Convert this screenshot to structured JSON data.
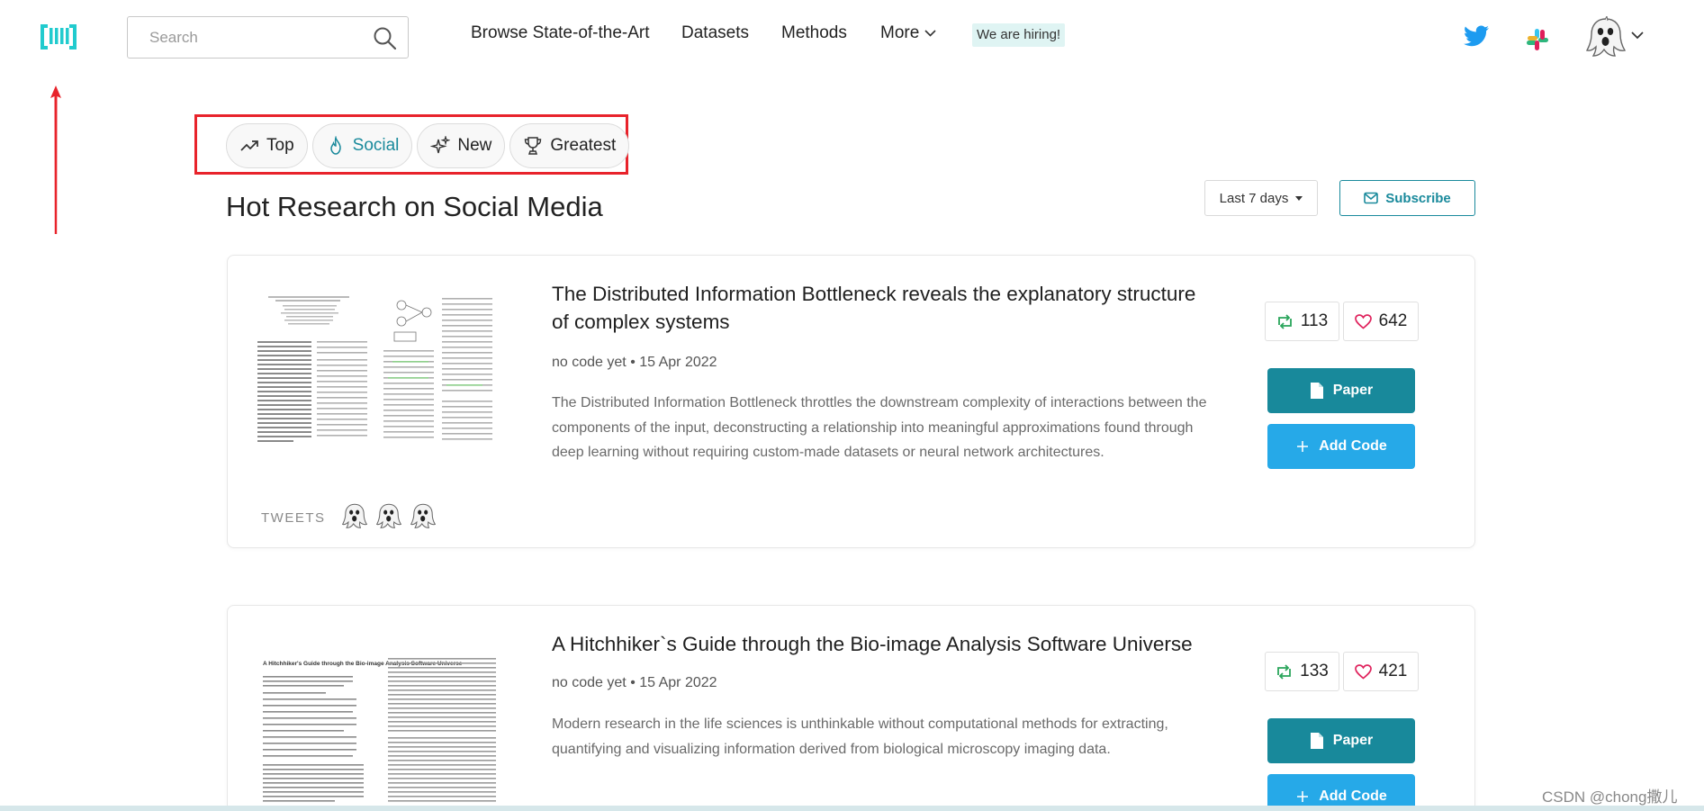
{
  "nav": {
    "search_placeholder": "Search",
    "links": [
      "Browse State-of-the-Art",
      "Datasets",
      "Methods",
      "More"
    ],
    "hiring": "We are hiring!"
  },
  "filters": [
    {
      "label": "Top",
      "icon": "trending-up-icon",
      "active": false
    },
    {
      "label": "Social",
      "icon": "flame-icon",
      "active": true
    },
    {
      "label": "New",
      "icon": "sparkles-icon",
      "active": false
    },
    {
      "label": "Greatest",
      "icon": "trophy-icon",
      "active": false
    }
  ],
  "page_title": "Hot Research on Social Media",
  "range_select": "Last 7 days",
  "subscribe_label": "Subscribe",
  "papers": [
    {
      "title": "The Distributed Information Bottleneck reveals the explanatory structure of complex systems",
      "code_status": "no code yet",
      "date": "15 Apr 2022",
      "abstract": "The Distributed Information Bottleneck throttles the downstream complexity of interactions between the components of the input, deconstructing a relationship into meaningful approximations found through deep learning without requiring custom-made datasets or neural network architectures.",
      "retweets": "113",
      "likes": "642",
      "paper_label": "Paper",
      "code_label": "Add Code",
      "tweets_label": "TWEETS"
    },
    {
      "title": "A Hitchhiker`s Guide through the Bio-image Analysis Software Universe",
      "code_status": "no code yet",
      "date": "15 Apr 2022",
      "abstract": "Modern research in the life sciences is unthinkable without computational methods for extracting, quantifying and visualizing information derived from biological microscopy imaging data.",
      "retweets": "133",
      "likes": "421",
      "paper_label": "Paper",
      "code_label": "Add Code"
    }
  ],
  "thumb_2_heading": "A Hitchhiker's Guide through the Bio-image Analysis Software Universe",
  "watermark": "CSDN @chong撒儿",
  "colors": {
    "accent": "#18899b",
    "code_button": "#26a9e8",
    "annotation_red": "#e8232b",
    "hiring_bg": "#dff4f3"
  }
}
